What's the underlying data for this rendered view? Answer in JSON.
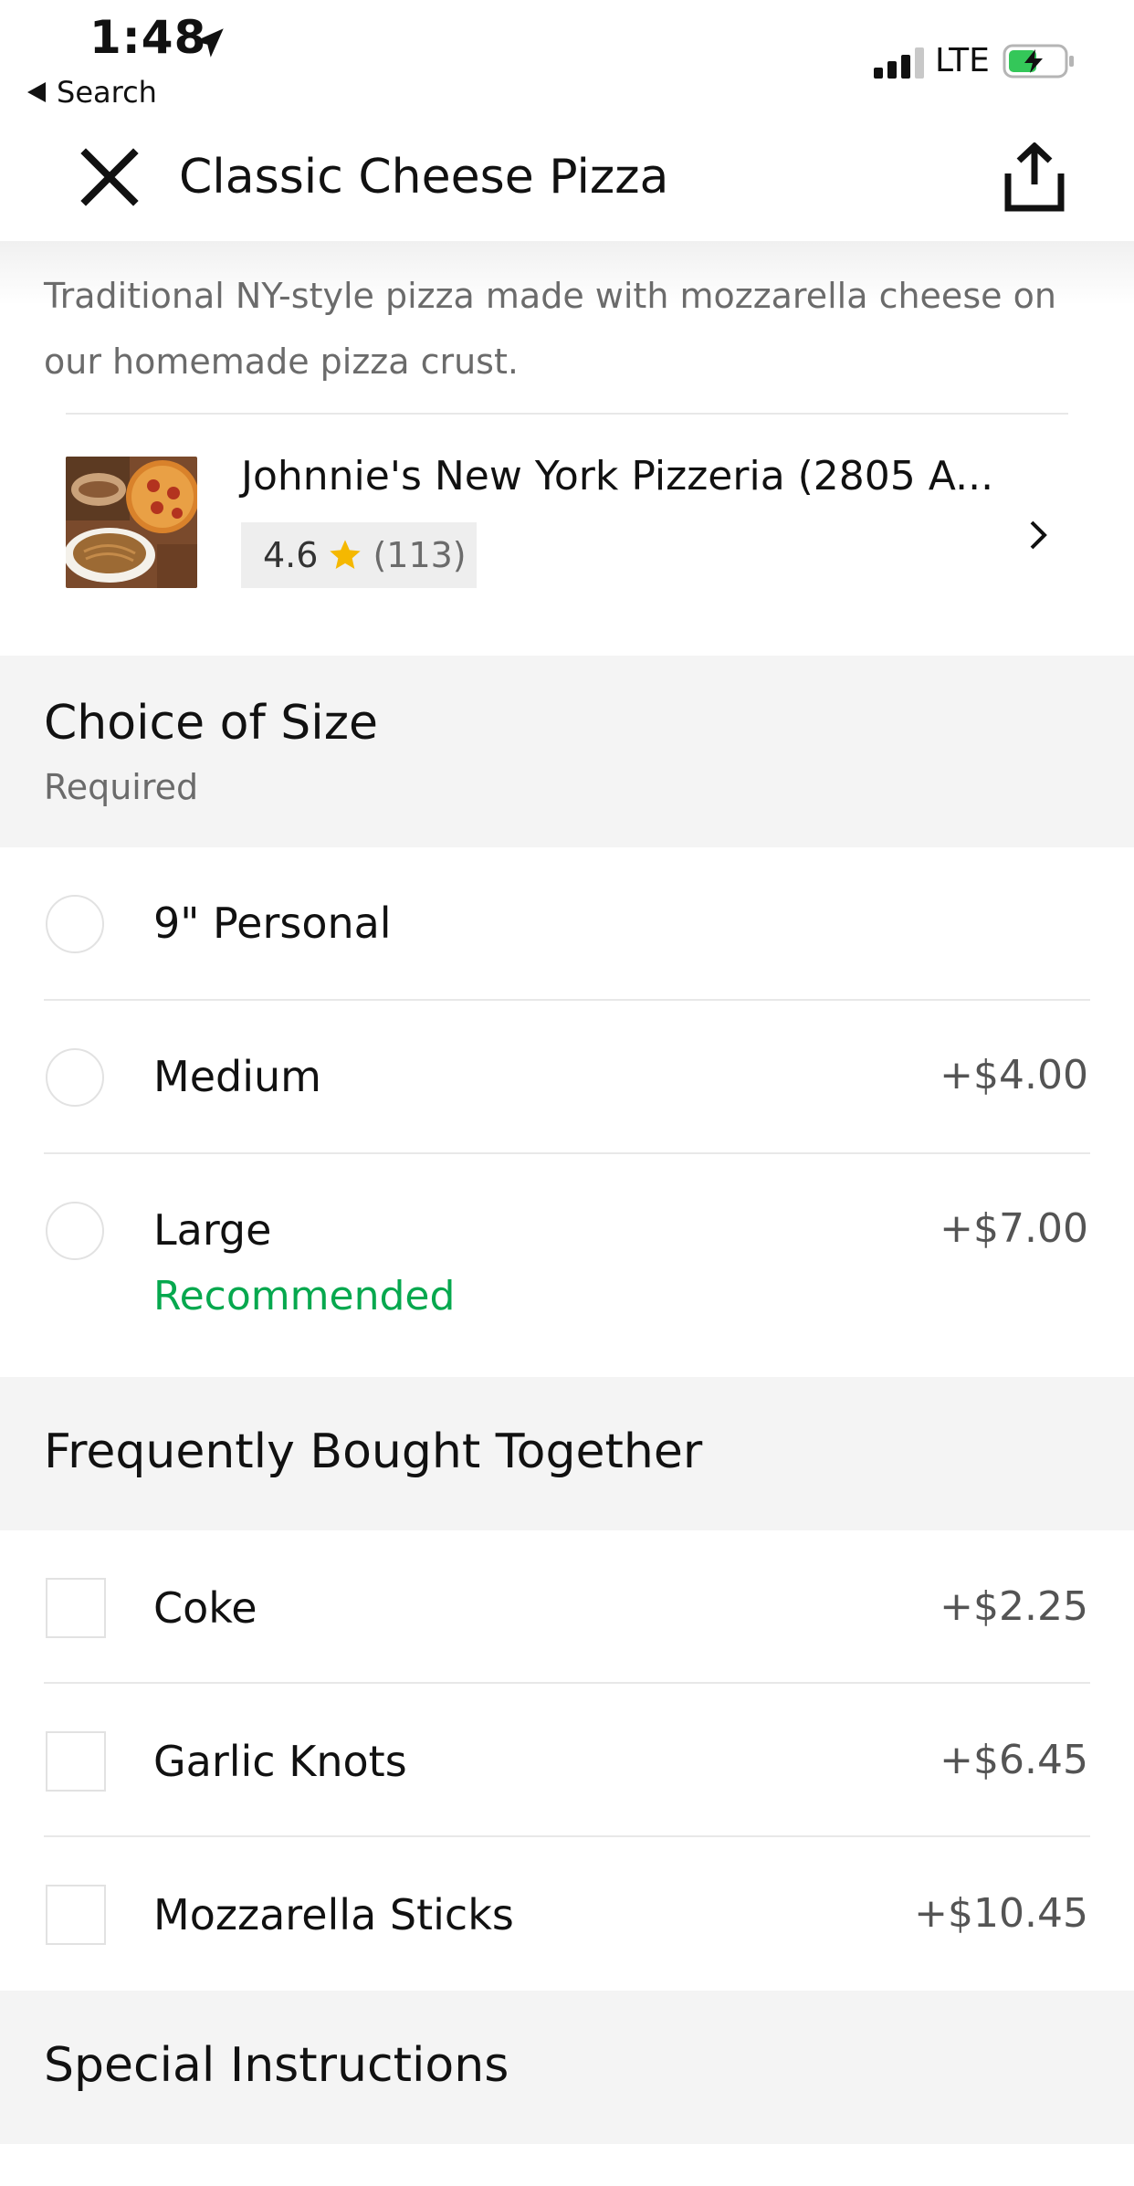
{
  "status_bar": {
    "time": "1:48",
    "carrier": "LTE",
    "back_label": "Search"
  },
  "header": {
    "title": "Classic Cheese Pizza"
  },
  "item": {
    "description": "Traditional NY-style pizza made with mozzarella cheese on our homemade pizza crust."
  },
  "restaurant": {
    "name": "Johnnie's New York Pizzeria (2805 A...",
    "rating": "4.6",
    "rating_count": "(113)"
  },
  "size_section": {
    "title": "Choice of Size",
    "subtitle": "Required",
    "options": [
      {
        "label": "9\" Personal",
        "price": ""
      },
      {
        "label": "Medium",
        "price": "+$4.00"
      },
      {
        "label": "Large",
        "price": "+$7.00",
        "badge": "Recommended"
      }
    ]
  },
  "frequently_bought": {
    "title": "Frequently Bought Together",
    "items": [
      {
        "label": "Coke",
        "price": "+$2.25"
      },
      {
        "label": "Garlic Knots",
        "price": "+$6.45"
      },
      {
        "label": "Mozzarella Sticks",
        "price": "+$10.45"
      }
    ]
  },
  "special_instructions": {
    "title": "Special Instructions"
  },
  "colors": {
    "accent_green": "#06a84e",
    "star": "#f5b800",
    "band": "#f4f4f4"
  },
  "icons": [
    "location-arrow-icon",
    "back-arrow-icon",
    "signal-icon",
    "battery-charging-icon",
    "close-icon",
    "share-icon",
    "star-icon",
    "chevron-right-icon"
  ]
}
